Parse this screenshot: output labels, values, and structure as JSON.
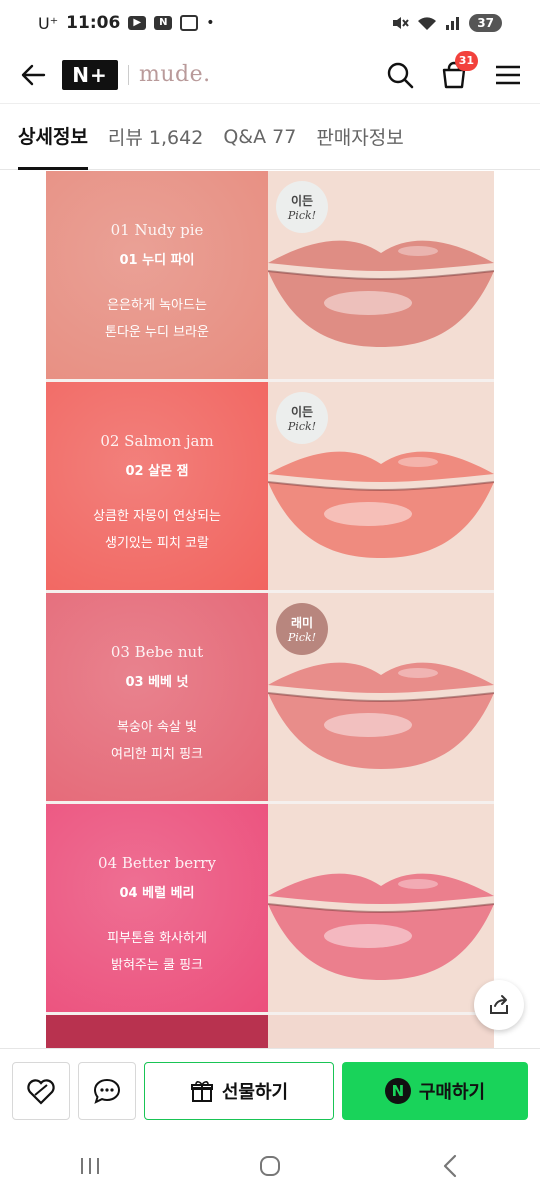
{
  "status": {
    "carrier": "U⁺",
    "time": "11:06",
    "battery": "37"
  },
  "header": {
    "logo": "N+",
    "brand": "mude.",
    "cart_count": "31"
  },
  "tabs": [
    {
      "label": "상세정보",
      "active": true
    },
    {
      "label": "리뷰 1,642"
    },
    {
      "label": "Q&A 77"
    },
    {
      "label": "판매자정보"
    }
  ],
  "shades": [
    {
      "en": "01 Nudy pie",
      "ko": "01 누디 파이",
      "desc1": "은은하게 녹아드는",
      "desc2": "톤다운 누디 브라운",
      "pick": "이든",
      "swatch_color": "#e78d80",
      "lip_color": "#df8d84"
    },
    {
      "en": "02 Salmon jam",
      "ko": "02 살몬 잼",
      "desc1": "상큼한 자몽이 연상되는",
      "desc2": "생기있는 피치 코랄",
      "pick": "이든",
      "swatch_color": "#f2645f",
      "lip_color": "#ef8b7f"
    },
    {
      "en": "03 Bebe nut",
      "ko": "03 베베 넛",
      "desc1": "복숭아 속살 빛",
      "desc2": "여리한 피치 핑크",
      "pick": "래미",
      "swatch_color": "#e56776",
      "lip_color": "#e88d8a"
    },
    {
      "en": "04 Better berry",
      "ko": "04 베럴 베리",
      "desc1": "피부톤을 화사하게",
      "desc2": "밝혀주는 쿨 핑크",
      "pick": "",
      "swatch_color": "#ec4f7c",
      "lip_color": "#eb7f8d"
    }
  ],
  "pick_word": "Pick!",
  "actions": {
    "gift_label": "선물하기",
    "buy_label": "구매하기",
    "npay_letter": "N"
  },
  "colors": {
    "accent_green": "#19d35a",
    "badge_red": "#f2413c"
  }
}
